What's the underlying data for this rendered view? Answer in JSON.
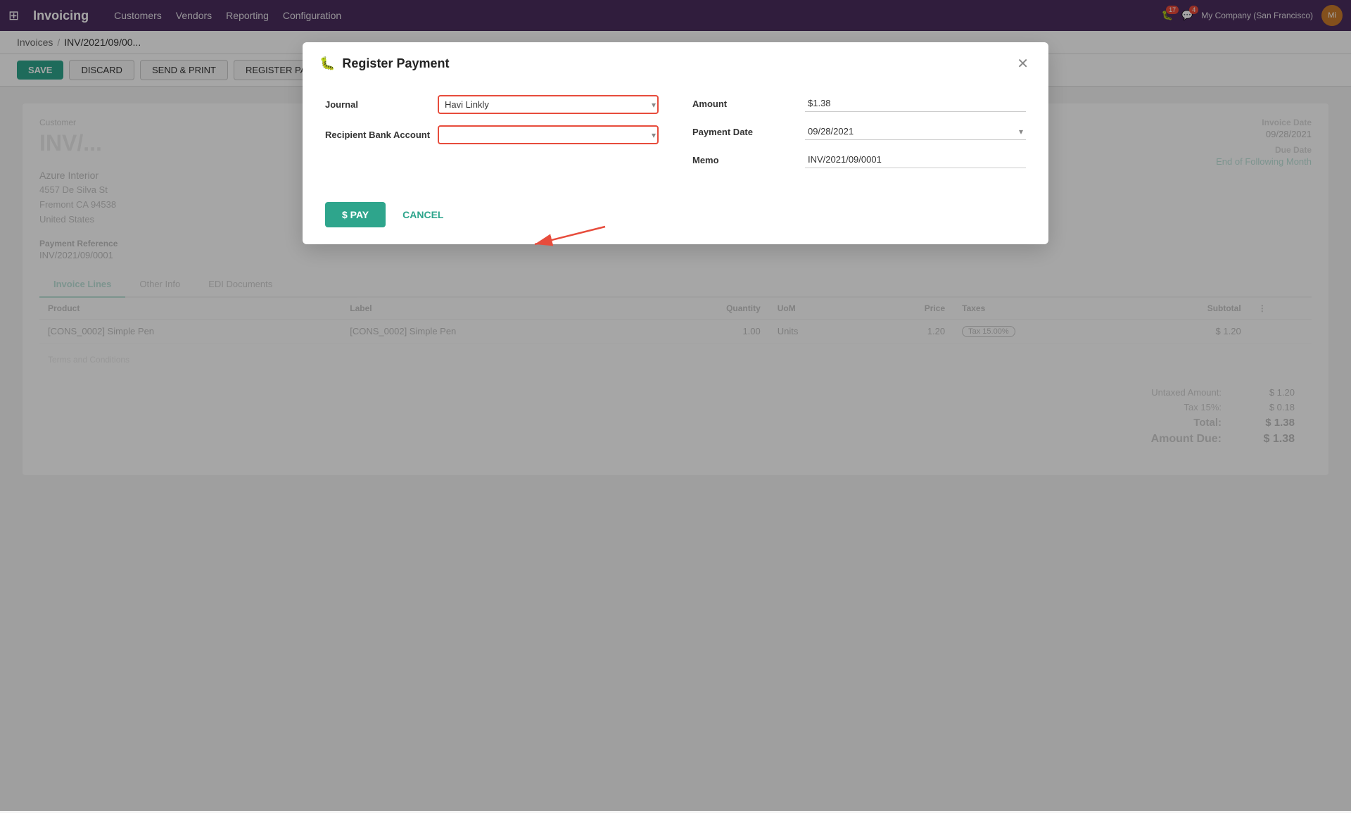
{
  "topnav": {
    "app_title": "Invoicing",
    "menu_items": [
      "Customers",
      "Vendors",
      "Reporting",
      "Configuration"
    ],
    "notification_count_1": "17",
    "notification_count_2": "4",
    "company": "My Company (San Francisco)",
    "avatar_initials": "Mi"
  },
  "breadcrumb": {
    "parent": "Invoices",
    "separator": "/",
    "current": "INV/2021/09/00..."
  },
  "action_bar": {
    "save_label": "SAVE",
    "discard_label": "DISCARD",
    "send_print_label": "SEND & PRINT",
    "register_label": "REGISTER PAYM..."
  },
  "invoice": {
    "customer_label": "Customer",
    "number": "INV/...",
    "customer_name": "Azure Interior",
    "address_line1": "4557 De Silva St",
    "address_line2": "Fremont CA 94538",
    "address_line3": "United States",
    "invoice_date_label": "Invoice Date",
    "invoice_date_value": "09/28/2021",
    "due_date_label": "Due Date",
    "due_date_value": "End of Following Month",
    "payment_ref_label": "Payment Reference",
    "payment_ref_value": "INV/2021/09/0001",
    "tabs": [
      "Invoice Lines",
      "Other Info",
      "EDI Documents"
    ],
    "table_headers": [
      "Product",
      "Label",
      "Quantity",
      "UoM",
      "Price",
      "Taxes",
      "Subtotal"
    ],
    "table_rows": [
      {
        "product": "[CONS_0002] Simple Pen",
        "label": "[CONS_0002] Simple Pen",
        "quantity": "1.00",
        "uom": "Units",
        "price": "1.20",
        "taxes": "Tax 15.00%",
        "subtotal": "$ 1.20"
      }
    ],
    "terms_placeholder": "Terms and Conditions",
    "untaxed_label": "Untaxed Amount:",
    "untaxed_value": "$ 1.20",
    "tax_label": "Tax 15%:",
    "tax_value": "$ 0.18",
    "total_label": "Total:",
    "total_value": "$ 1.38",
    "amount_due_label": "Amount Due:",
    "amount_due_value": "$ 1.38"
  },
  "modal": {
    "title": "Register Payment",
    "title_icon": "💳",
    "journal_label": "Journal",
    "journal_value": "Havi Linkly",
    "recipient_bank_label": "Recipient Bank Account",
    "recipient_bank_value": "",
    "amount_label": "Amount",
    "amount_value": "$1.38",
    "payment_date_label": "Payment Date",
    "payment_date_value": "09/28/2021",
    "memo_label": "Memo",
    "memo_value": "INV/2021/09/0001",
    "pay_button": "$ PAY",
    "cancel_button": "CANCEL"
  }
}
